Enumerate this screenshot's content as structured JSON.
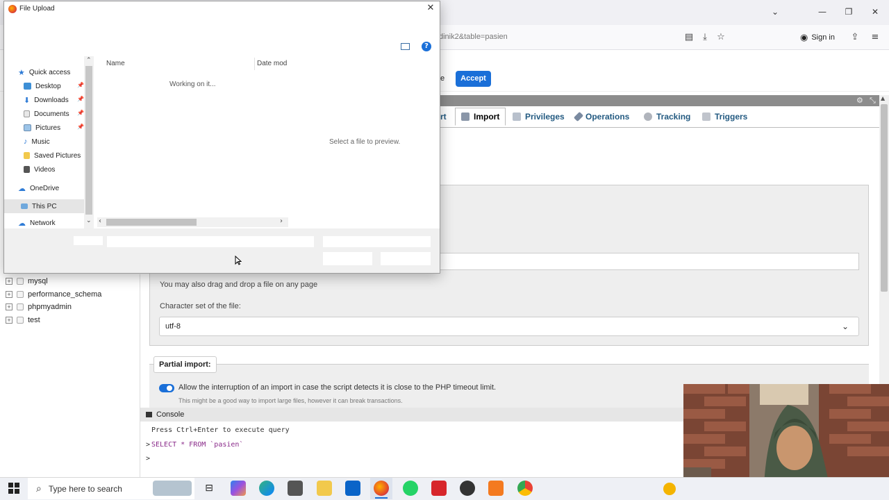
{
  "browser": {
    "url_fragment": "dinik2&table=pasien",
    "sign_in_label": "Sign in",
    "accept_label": "Accept",
    "cookie_partial": "e"
  },
  "pma": {
    "tabs": [
      {
        "label": "rt",
        "icon": "export-icon"
      },
      {
        "label": "Import",
        "icon": "import-icon"
      },
      {
        "label": "Privileges",
        "icon": "privileges-icon"
      },
      {
        "label": "Operations",
        "icon": "operations-icon"
      },
      {
        "label": "Tracking",
        "icon": "tracking-icon"
      },
      {
        "label": "Triggers",
        "icon": "triggers-icon"
      }
    ],
    "drag_text": "You may also drag and drop a file on any page",
    "charset_label": "Character set of the file:",
    "charset_value": "utf-8",
    "partial_legend": "Partial import:",
    "allow_interrupt": "Allow the interruption of an import in case the script detects it is close to the PHP timeout limit.",
    "interrupt_hint": "This might be a good way to import large files, however it can break transactions."
  },
  "sidebar": {
    "databases": [
      "mysql",
      "performance_schema",
      "phpmyadmin",
      "test"
    ]
  },
  "console": {
    "title": "Console",
    "hint": "Press Ctrl+Enter to execute query",
    "last_query": "SELECT * FROM `pasien`"
  },
  "dialog": {
    "title": "File Upload",
    "nav": {
      "quick_access": "Quick access",
      "items": [
        "Desktop",
        "Downloads",
        "Documents",
        "Pictures",
        "Music",
        "Saved Pictures",
        "Videos"
      ],
      "onedrive": "OneDrive",
      "this_pc": "This PC",
      "network": "Network"
    },
    "columns": {
      "name": "Name",
      "date": "Date mod"
    },
    "status": "Working on it...",
    "preview": "Select a file to preview."
  },
  "taskbar": {
    "search_placeholder": "Type here to search"
  }
}
